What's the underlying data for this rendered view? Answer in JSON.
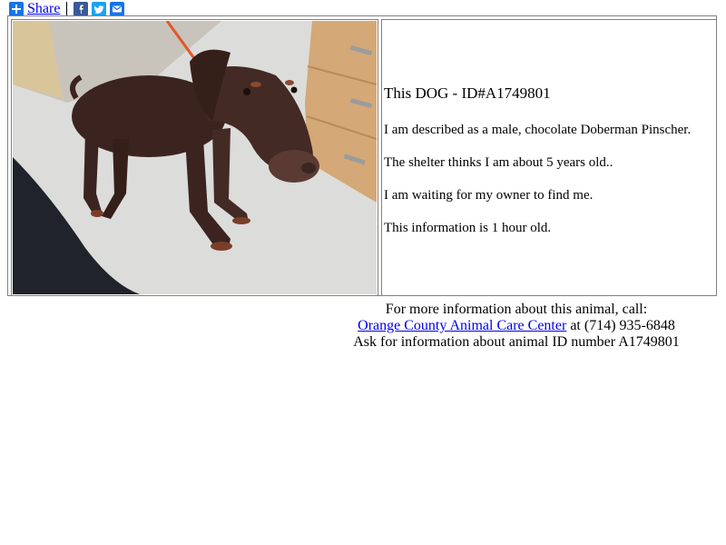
{
  "share": {
    "label": "Share",
    "icons": [
      "plus-share-icon",
      "facebook-icon",
      "twitter-icon",
      "email-icon"
    ]
  },
  "photo": {
    "description_icon": "dog-photo"
  },
  "info": {
    "title_prefix": "This DOG - ",
    "title_id": "ID#A1749801",
    "described": "I am described as a male, chocolate Doberman Pinscher.",
    "age": "The shelter thinks I am about 5 years old..",
    "waiting": "I am waiting for my owner to find me.",
    "freshness": "This information is 1 hour old."
  },
  "contact": {
    "intro": "For more information about this animal, call:",
    "center_name": "Orange County Animal Care Center",
    "phone_text": " at (714) 935-6848",
    "ask_text": "Ask for information about animal ID number A1749801"
  },
  "colors": {
    "link": "#0000ee",
    "facebook": "#3b5998",
    "twitter": "#1da1f2",
    "email": "#1a73e8"
  }
}
